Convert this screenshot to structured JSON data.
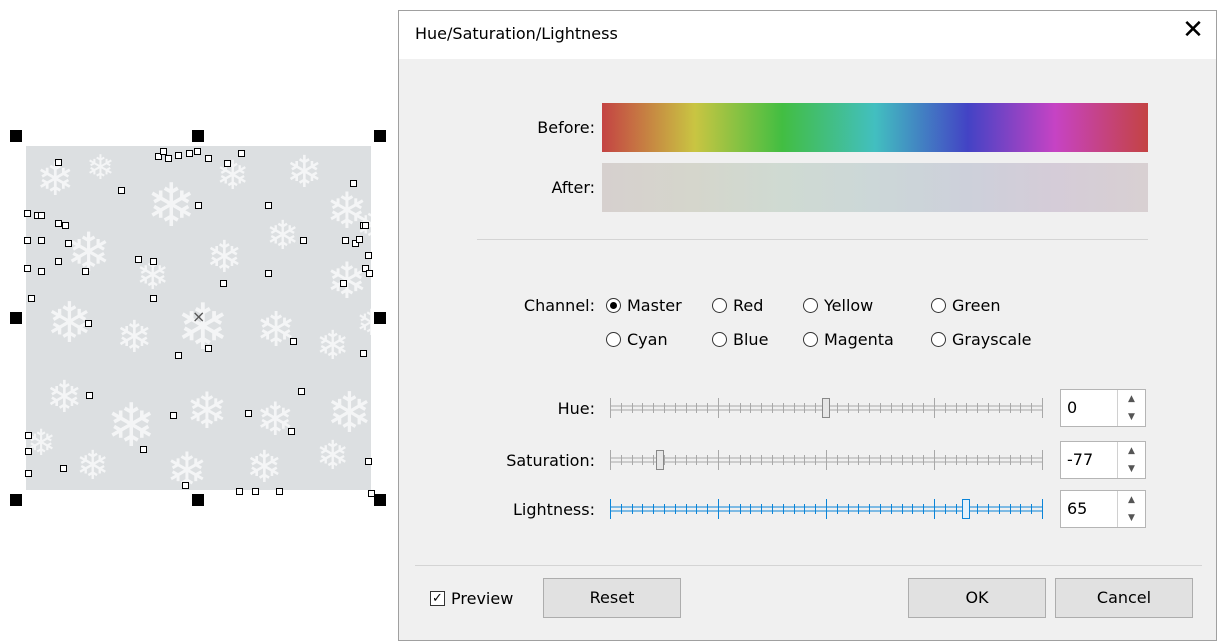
{
  "dialog": {
    "title": "Hue/Saturation/Lightness",
    "close_label": "✕",
    "before_label": "Before:",
    "after_label": "After:",
    "channel_label": "Channel:",
    "channels": [
      {
        "label": "Master",
        "checked": true
      },
      {
        "label": "Red",
        "checked": false
      },
      {
        "label": "Yellow",
        "checked": false
      },
      {
        "label": "Green",
        "checked": false
      },
      {
        "label": "Cyan",
        "checked": false
      },
      {
        "label": "Blue",
        "checked": false
      },
      {
        "label": "Magenta",
        "checked": false
      },
      {
        "label": "Grayscale",
        "checked": false
      }
    ],
    "sliders": [
      {
        "label": "Hue:",
        "value": "0",
        "fraction": 0.5,
        "active": false
      },
      {
        "label": "Saturation:",
        "value": "-77",
        "fraction": 0.115,
        "active": false
      },
      {
        "label": "Lightness:",
        "value": "65",
        "fraction": 0.825,
        "active": true
      }
    ],
    "preview_label": "Preview",
    "preview_checked": true,
    "reset_label": "Reset",
    "ok_label": "OK",
    "cancel_label": "Cancel",
    "colors": {
      "active_slider": "#0a84d8",
      "inactive_slider": "#a8a8a8"
    }
  },
  "canvas": {
    "center_mark": "×"
  }
}
